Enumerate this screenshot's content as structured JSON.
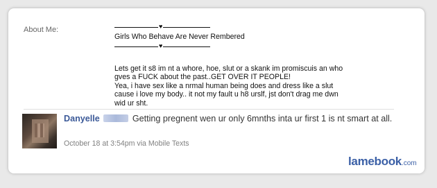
{
  "about": {
    "label": "About Me:",
    "divider_glyph": "♥",
    "headline": "Girls Who Behave Are Never Rembered",
    "paragraph": "Lets get it s8 im nt a whore, hoe, slut or a skank im promiscuis an who\ngves a FUCK about the past..GET OVER IT PEOPLE!\nYea, i have sex like a nrmal human being does and dress like a slut\ncause i love my body.. it not my fault u h8 urslf, jst don't drag me dwn\nwid ur sht."
  },
  "status": {
    "author": "Danyelle",
    "text": "Getting pregnent wen ur only 6mnths inta ur first 1 is nt smart at all.",
    "meta": "October 18 at 3:54pm via Mobile Texts"
  },
  "watermark": {
    "brand": "lamebook",
    "tld": ".com"
  },
  "colors": {
    "name_link": "#3b5998",
    "watermark": "#3a5fa6"
  }
}
